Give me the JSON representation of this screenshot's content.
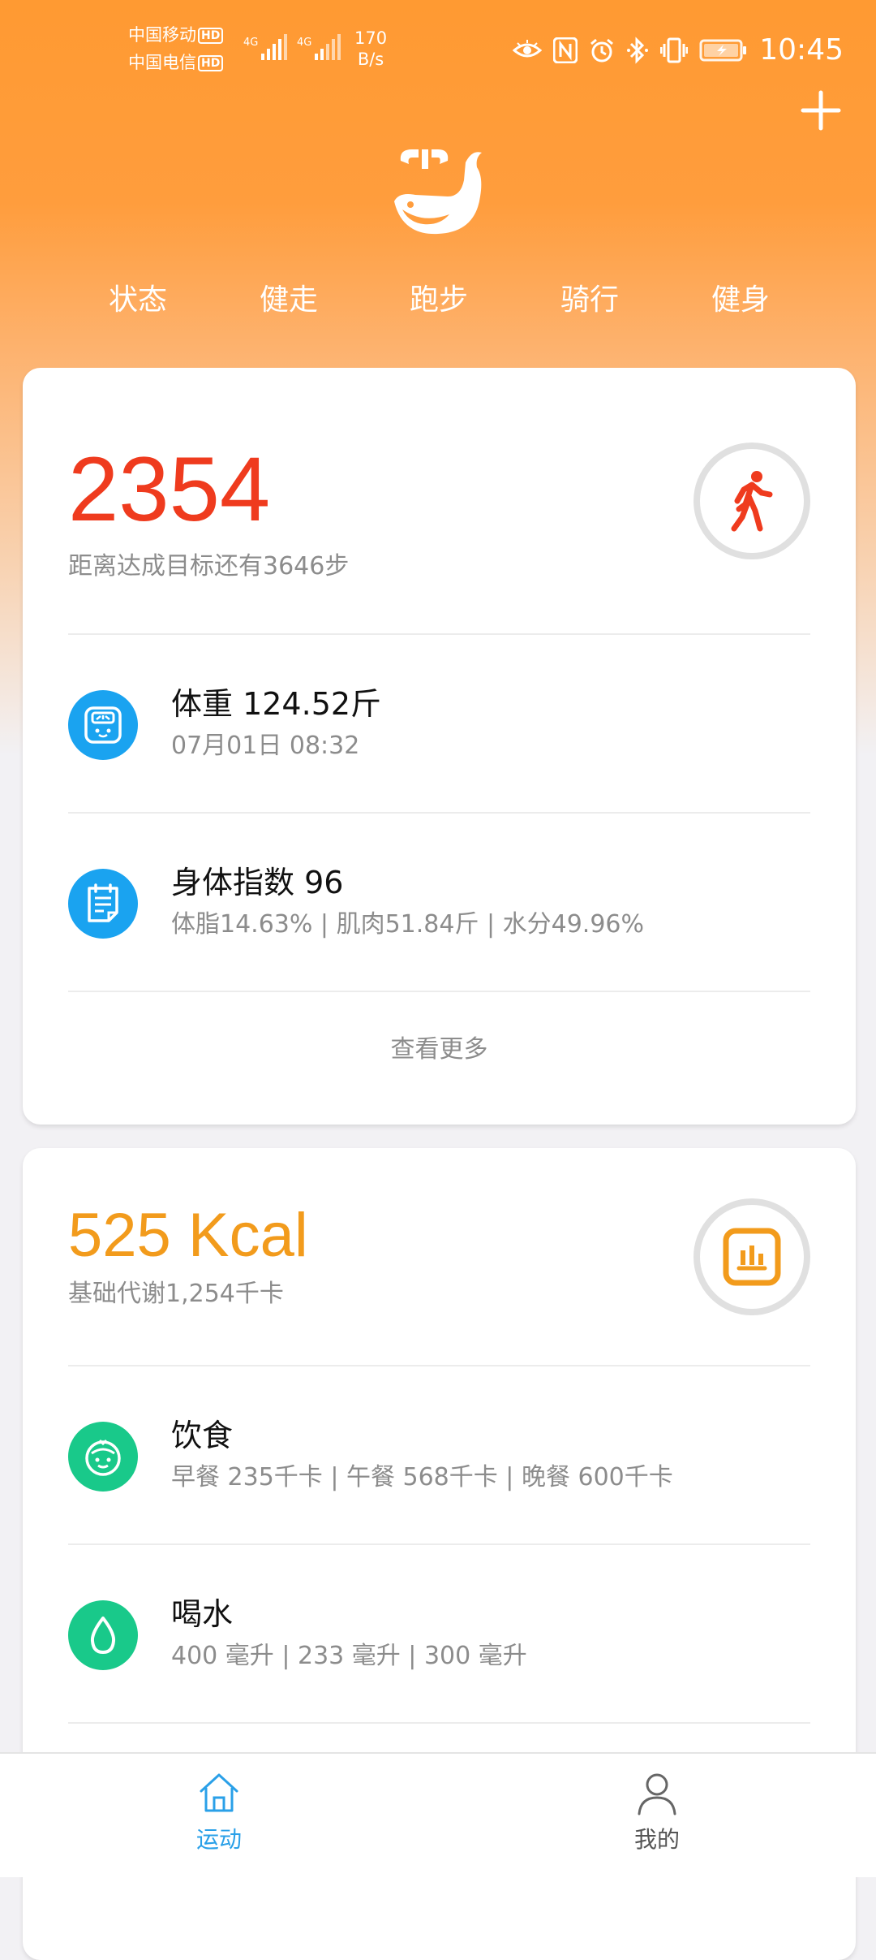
{
  "status_bar": {
    "carrier1": "中国移动",
    "carrier2": "中国电信",
    "hd": "HD",
    "net1": "4G",
    "net2": "4G",
    "speed_value": "170",
    "speed_unit": "B/s",
    "time": "10:45",
    "icons": [
      "eye-icon",
      "nfc-icon",
      "alarm-icon",
      "bluetooth-icon",
      "vibrate-icon",
      "battery-charging-icon"
    ]
  },
  "header": {
    "add_icon": "plus-icon",
    "logo": "whale-logo",
    "tabs": [
      {
        "label": "状态"
      },
      {
        "label": "健走"
      },
      {
        "label": "跑步"
      },
      {
        "label": "骑行"
      },
      {
        "label": "健身"
      }
    ]
  },
  "steps_card": {
    "steps": "2354",
    "goal_text": "距离达成目标还有3646步",
    "icon": "walking-person-icon",
    "weight": {
      "title": "体重 124.52斤",
      "subtitle": "07月01日 08:32",
      "icon": "scale-icon"
    },
    "body_index": {
      "title": "身体指数 96",
      "subtitle": "体脂14.63% | 肌肉51.84斤 | 水分49.96%",
      "icon": "report-icon"
    },
    "view_more": "查看更多"
  },
  "kcal_card": {
    "kcal": "525 Kcal",
    "bmr_text": "基础代谢1,254千卡",
    "icon": "bar-chart-icon",
    "diet": {
      "title": "饮食",
      "subtitle": "早餐 235千卡 | 午餐 568千卡 | 晚餐 600千卡",
      "icon": "food-icon"
    },
    "water": {
      "title": "喝水",
      "subtitle": "400 毫升 | 233 毫升 | 300 毫升",
      "icon": "water-drop-icon"
    }
  },
  "bottom_nav": {
    "items": [
      {
        "label": "运动",
        "icon": "home-icon",
        "active": true
      },
      {
        "label": "我的",
        "icon": "user-icon",
        "active": false
      }
    ]
  },
  "colors": {
    "accent_orange": "#ff9a32",
    "steps_red": "#ef3b1e",
    "kcal_orange": "#f29b1c",
    "blue_icon": "#1aa3f0",
    "green_icon": "#19c98a",
    "nav_active": "#2aa0e8"
  }
}
